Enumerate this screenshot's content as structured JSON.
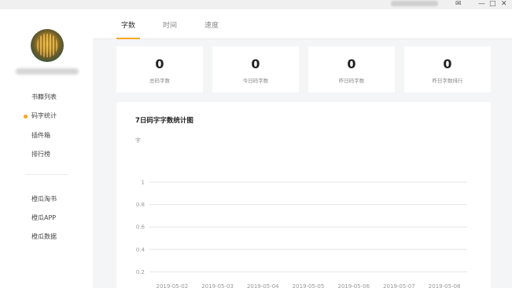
{
  "titlebar": {
    "icons": [
      "mail-icon",
      "minimize-icon",
      "maximize-icon",
      "close-icon"
    ]
  },
  "sidebar": {
    "items": [
      {
        "label": "书籍列表",
        "active": false
      },
      {
        "label": "码字统计",
        "active": true
      },
      {
        "label": "插件箱",
        "active": false
      },
      {
        "label": "排行榜",
        "active": false
      }
    ],
    "links": [
      {
        "label": "橙瓜淘书"
      },
      {
        "label": "橙瓜APP"
      },
      {
        "label": "橙瓜数据"
      }
    ],
    "accent": "#f5a623"
  },
  "tabs": [
    {
      "label": "字数",
      "active": true
    },
    {
      "label": "时间",
      "active": false
    },
    {
      "label": "速度",
      "active": false
    }
  ],
  "stats": [
    {
      "value": "0",
      "label": "总码字数"
    },
    {
      "value": "0",
      "label": "今日码字数"
    },
    {
      "value": "0",
      "label": "昨日码字数"
    },
    {
      "value": "0",
      "label": "昨日字数排行"
    }
  ],
  "chart_data": {
    "type": "line",
    "title": "7日码字字数统计图",
    "ylabel": "字",
    "x": [
      "2019-05-02",
      "2019-05-03",
      "2019-05-04",
      "2019-05-05",
      "2019-05-06",
      "2019-05-07",
      "2019-05-08"
    ],
    "series": [
      {
        "values": [
          0,
          0,
          0,
          0,
          0,
          0,
          0
        ]
      }
    ],
    "ylim": [
      0,
      1
    ],
    "yticks": [
      "0",
      "0.2",
      "0.4",
      "0.6",
      "0.8",
      "1"
    ],
    "grid": true
  }
}
